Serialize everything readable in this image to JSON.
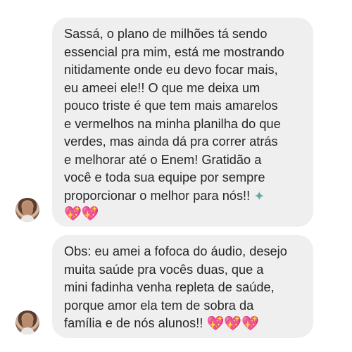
{
  "messages": [
    {
      "text": "Sassá, o plano de milhões tá sendo\nessencial pra mim, está me mostrando\nnitidamente onde eu devo focar mais,\neu ameei ele!! O que me deixa um\npouco triste é que tem mais amarelos\ne vermelhos na minha planilha do que\nverdes, mas ainda dá pra correr atrás\ne melhorar até o Enem! Gratidão a\nvocê e toda sua equipe por sempre\nproporcionar o melhor para nós!! ",
      "emojis": [
        "✦",
        "💖",
        "💖"
      ],
      "emoji_names": [
        "fairy-emoji",
        "sparkling-heart-emoji",
        "sparkling-heart-emoji"
      ]
    },
    {
      "text": "Obs: eu amei a fofoca do áudio, desejo\nmuita saúde pra vocês duas, que a\nmini fadinha venha repleta de saúde,\nporque amor ela tem de sobra da\nfamília e de nós alunos!! ",
      "emojis": [
        "💖",
        "💖",
        "💖"
      ],
      "emoji_names": [
        "sparkling-heart-emoji",
        "sparkling-heart-emoji",
        "sparkling-heart-emoji"
      ]
    }
  ],
  "colors": {
    "bubble": "#efefef",
    "text": "#262626",
    "heart": "#ff2d8f",
    "fairy": "#68a9a2"
  }
}
